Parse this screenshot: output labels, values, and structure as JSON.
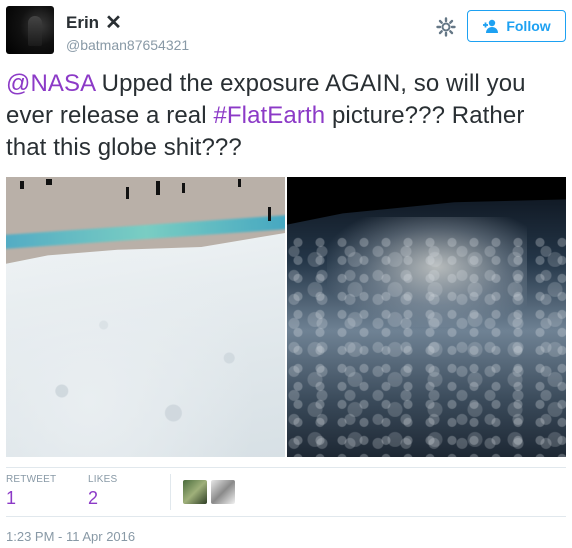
{
  "user": {
    "display_name": "Erin",
    "badge_glyph": "✕",
    "handle": "@batman87654321"
  },
  "actions": {
    "follow_label": "Follow"
  },
  "tweet": {
    "mention": "@NASA",
    "text_part1": " Upped the exposure AGAIN, so will you ever release a real ",
    "hashtag": "#FlatEarth",
    "text_part2": " picture??? Rather that this globe shit???"
  },
  "media": {
    "photos": [
      "earth-white-overexposed",
      "earth-dark-normal"
    ]
  },
  "stats": {
    "retweets_label": "RETWEET",
    "retweets_value": "1",
    "likes_label": "LIKES",
    "likes_value": "2"
  },
  "timestamp": "1:23 PM - 11 Apr 2016",
  "colors": {
    "link": "#8c3ac7",
    "follow_blue": "#1da1f2",
    "muted": "#8899a6",
    "text": "#292f33"
  }
}
